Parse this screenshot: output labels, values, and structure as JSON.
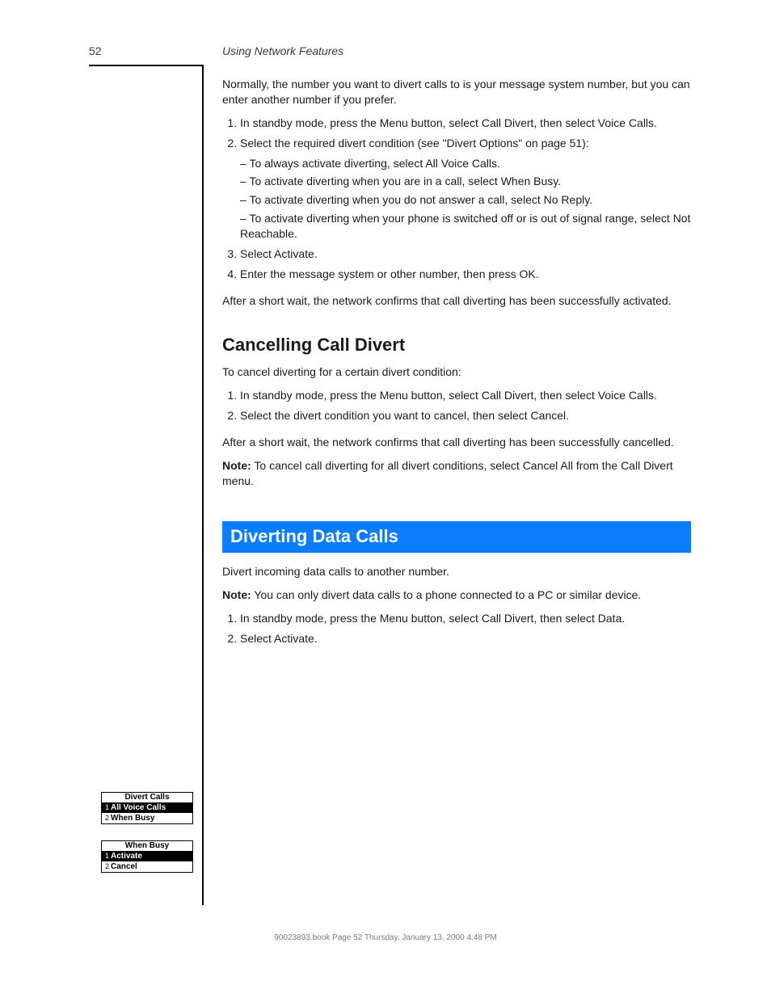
{
  "page_number": "52",
  "header_title": "Using Network Features",
  "intro_para": "Normally, the number you want to divert calls to is your message system number, but you can enter another number if you prefer.",
  "steps1": [
    {
      "text": "In standby mode, press the Menu button, select Call Divert, then select Voice Calls."
    },
    {
      "text": "Select the required divert condition (see \"Divert Options\" on page 51):",
      "sub": [
        "To always activate diverting, select All Voice Calls.",
        "To activate diverting when you are in a call, select When Busy.",
        "To activate diverting when you do not answer a call, select No Reply.",
        "To activate diverting when your phone is switched off or is out of signal range, select Not Reachable."
      ]
    },
    {
      "text": "Select Activate."
    },
    {
      "text": "Enter the message system or other number, then press OK."
    }
  ],
  "after_steps1": "After a short wait, the network confirms that call diverting has been successfully activated.",
  "cancel_heading": "Cancelling Call Divert",
  "cancel_para": "To cancel diverting for a certain divert condition:",
  "steps2": [
    {
      "text": "In standby mode, press the Menu button, select Call Divert, then select Voice Calls."
    },
    {
      "text": "Select the divert condition you want to cancel, then select Cancel."
    }
  ],
  "after_steps2": "After a short wait, the network confirms that call diverting has been successfully cancelled.",
  "note1_label": "Note:",
  "note1_text": "To cancel call diverting for all divert conditions, select Cancel All from the Call Divert menu.",
  "section_title": "Diverting Data Calls",
  "data_para": "Divert incoming data calls to another number.",
  "note2_label": "Note:",
  "note2_text": "You can only divert data calls to a phone connected to a PC or similar device.",
  "steps3": [
    {
      "text": "In standby mode, press the Menu button, select Call Divert, then select Data."
    },
    {
      "text": "Select Activate."
    }
  ],
  "screen1": {
    "title": "Divert Calls",
    "rows": [
      {
        "num": "1",
        "label": "All Voice Calls",
        "selected": true
      },
      {
        "num": "2",
        "label": "When Busy",
        "selected": false
      }
    ]
  },
  "screen2": {
    "title": "When Busy",
    "rows": [
      {
        "num": "1",
        "label": "Activate",
        "selected": true
      },
      {
        "num": "2",
        "label": "Cancel",
        "selected": false
      }
    ]
  },
  "footer_text": "90023893.book  Page 52  Thursday, January 13, 2000  4:48 PM"
}
